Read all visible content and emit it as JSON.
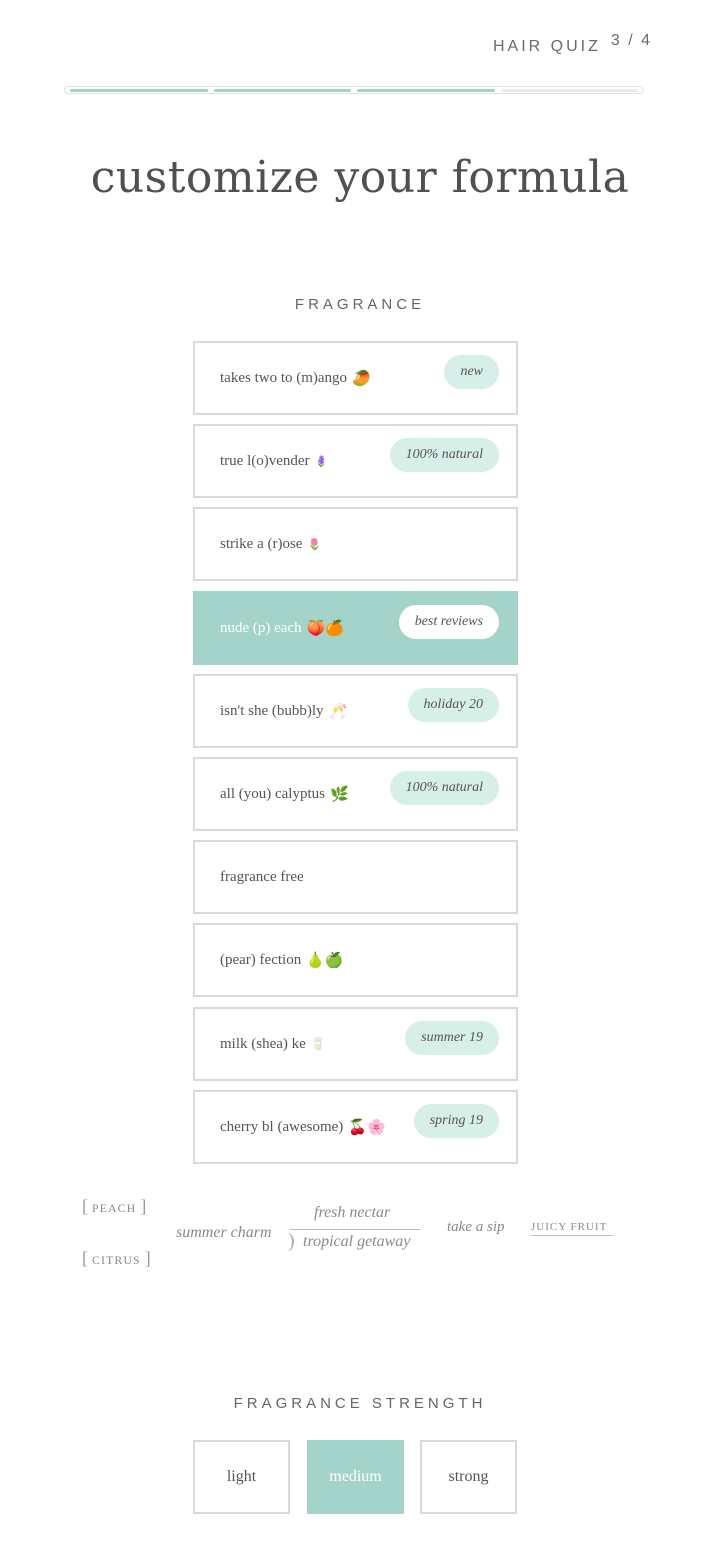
{
  "header": {
    "quiz_label": "HAIR QUIZ",
    "step": "3 / 4",
    "progress": {
      "completed": 3,
      "total": 4
    },
    "accent_color": "#a4d3c9"
  },
  "title": "customize your formula",
  "fragrance": {
    "heading": "FRAGRANCE",
    "options": [
      {
        "label": "takes two to (m)ango",
        "emoji": "🥭",
        "badge": "new",
        "selected": false
      },
      {
        "label": "true l(o)vender",
        "emoji": "🪻",
        "badge": "100% natural",
        "selected": false
      },
      {
        "label": "strike a (r)ose",
        "emoji": "🌷",
        "badge": "",
        "selected": false
      },
      {
        "label": "nude (p) each",
        "emoji": "🍑🍊",
        "badge": "best reviews",
        "selected": true
      },
      {
        "label": "isn't she (bubb)ly",
        "emoji": "🥂",
        "badge": "holiday 20",
        "selected": false
      },
      {
        "label": "all (you) calyptus",
        "emoji": "🌿",
        "badge": "100% natural",
        "selected": false
      },
      {
        "label": "fragrance free",
        "emoji": "",
        "badge": "",
        "selected": false
      },
      {
        "label": "(pear) fection",
        "emoji": "🍐🍏",
        "badge": "",
        "selected": false
      },
      {
        "label": "milk (shea) ke",
        "emoji": "🥛",
        "badge": "summer 19",
        "selected": false
      },
      {
        "label": "cherry bl (awesome)",
        "emoji": "🍒🌸",
        "badge": "spring 19",
        "selected": false
      }
    ]
  },
  "taglines": {
    "peach": "PEACH",
    "citrus": "CITRUS",
    "summer_charm": "summer charm",
    "fresh_nectar": "fresh nectar",
    "tropical_getaway": "tropical getaway",
    "take_a_sip": "take a sip",
    "juicy_fruit": "JUICY FRUIT"
  },
  "strength": {
    "heading": "FRAGRANCE STRENGTH",
    "options": [
      {
        "label": "light",
        "selected": false
      },
      {
        "label": "medium",
        "selected": true
      },
      {
        "label": "strong",
        "selected": false
      }
    ]
  }
}
